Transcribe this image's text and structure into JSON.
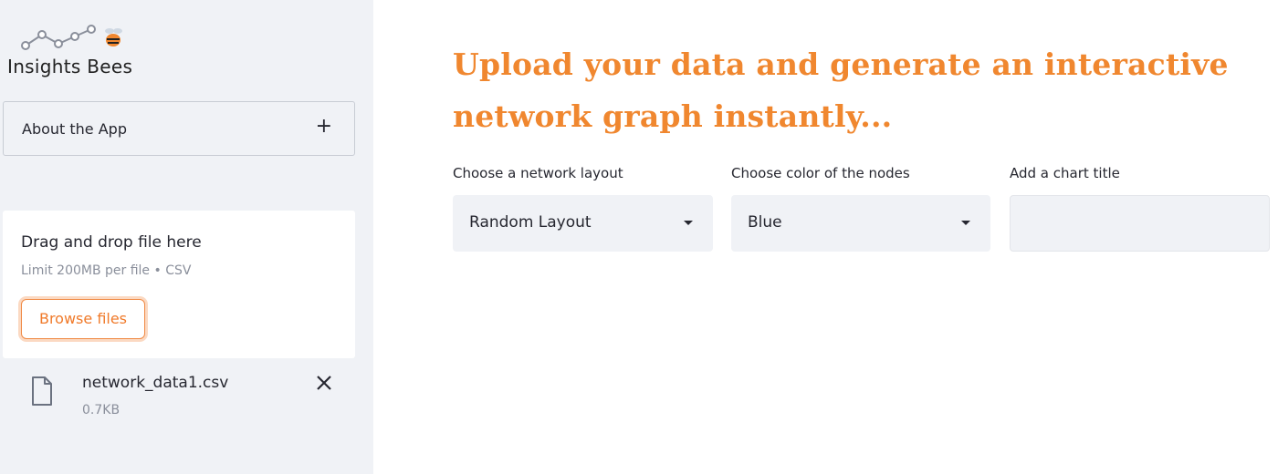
{
  "sidebar": {
    "logo": {
      "text": "Insights Bees",
      "icon": "network-line-bee-logo"
    },
    "expander": {
      "label": "About the App",
      "toggle": "+"
    },
    "uploader": {
      "title": "Drag and drop file here",
      "limit": "Limit 200MB per file • CSV",
      "browse_label": "Browse files"
    },
    "file": {
      "icon": "document-icon",
      "name": "network_data1.csv",
      "size": "0.7KB",
      "remove_icon": "close-icon"
    }
  },
  "main": {
    "headline_line1": "Upload your data and generate an interactive",
    "headline_line2": "network graph instantly...",
    "layout_select": {
      "label": "Choose a network layout",
      "value": "Random Layout"
    },
    "color_select": {
      "label": "Choose color of the nodes",
      "value": "Blue"
    },
    "title_input": {
      "label": "Add a chart title",
      "value": "",
      "placeholder": ""
    }
  },
  "colors": {
    "accent": "#f0872f",
    "sidebar_bg": "#f0f2f6",
    "text": "#262730",
    "muted": "#8a8f9b"
  }
}
